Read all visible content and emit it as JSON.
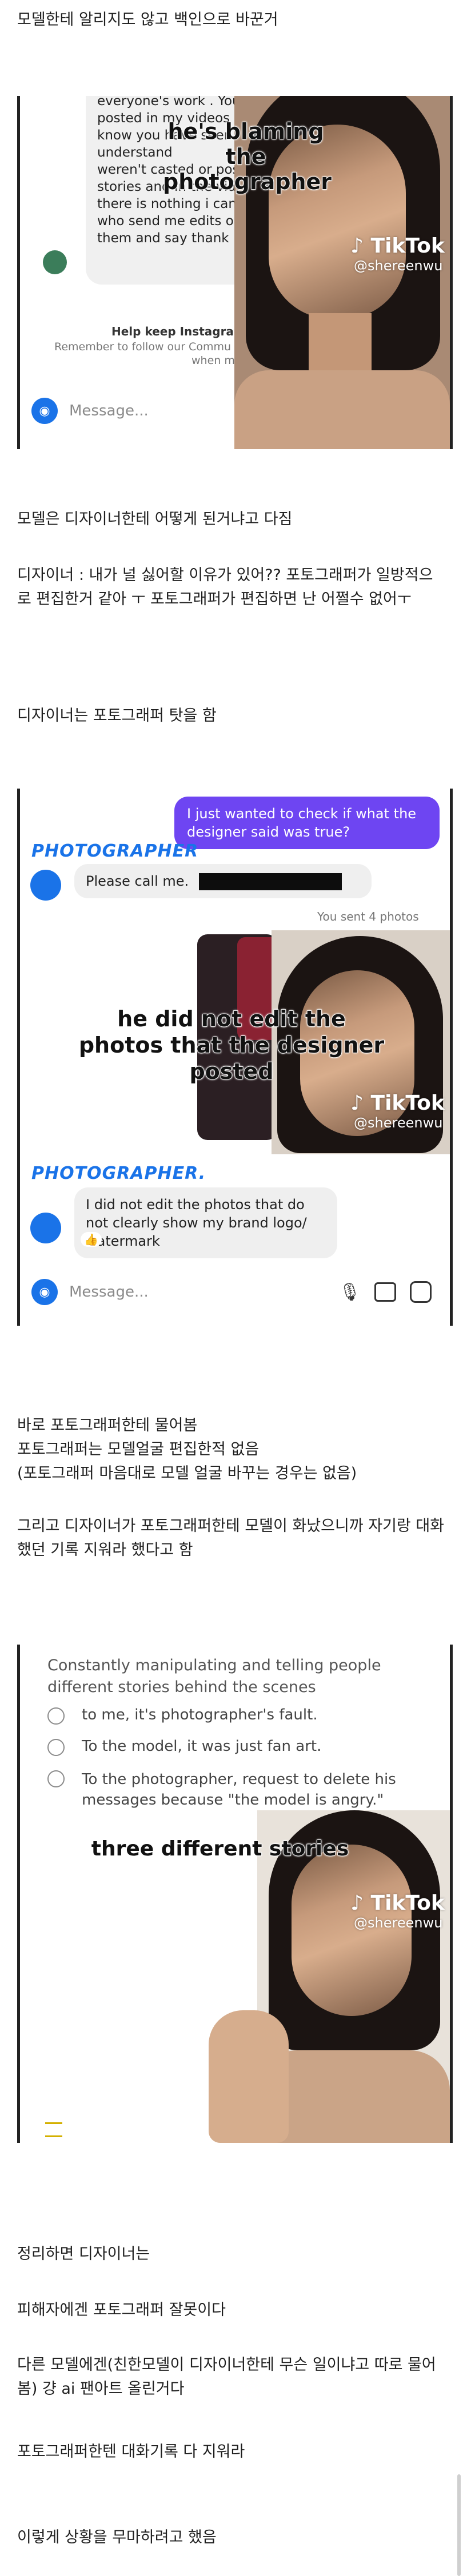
{
  "paragraphs": {
    "p1": "모델한테 알리지도 않고 백인으로 바꾼거",
    "p2": "모델은 디자이너한테 어떻게 된거냐고 다짐",
    "p3": "디자이너 : 내가 널 싫어할 이유가 있어?? 포토그래퍼가 일방적으로 편집한거 같아 ㅜ 포토그래퍼가 편집하면 난 어쩔수 없어ㅜ",
    "p4": "디자이너는 포토그래퍼 탓을 함",
    "p5a": "바로 포토그래퍼한테 물어봄",
    "p5b": "포토그래퍼는 모델얼굴 편집한적 없음",
    "p5c": "(포토그래퍼 마음대로 모델 얼굴 바꾸는 경우는 없음)",
    "p6": "그리고 디자이너가 포토그래퍼한테 모델이 화났으니까 자기랑 대화했던 기록 지워라 했다고 함",
    "p7": "정리하면 디자이너는",
    "p8": "피해자에겐 포토그래퍼 잘못이다",
    "p9": "다른 모델에겐(친한모델이 디자이너한테 무슨 일이냐고 따로 물어봄) 걍 ai 팬아트 올린거다",
    "p10": "포토그래퍼한텐 대화기록 다 지워라",
    "p11": "이렇게 상황을 무마하려고 했음"
  },
  "shot1": {
    "message_lines": [
      "everyone's work . Your photo was",
      "posted in my videos - and stories",
      "know you have seen it. I",
      "understand",
      "weren't casted or post",
      "stories and in the vide",
      "there is nothing i can",
      "who send me edits o",
      "them and say thank"
    ],
    "caption": "he's blaming the photographer",
    "help_title": "Help keep Instagram",
    "help_sub": "Remember to follow our Commu",
    "help_sub2": "when mess",
    "placeholder": "Message...",
    "tiktok": "TikTok",
    "handle": "@shereenwu"
  },
  "shot2": {
    "sent_message": "I just wanted to check if what the designer said was true?",
    "label1": "PHOTOGRAPHER",
    "reply1": "Please call me.",
    "sent_photos": "You sent 4 photos",
    "caption": "he did not edit the photos that the designer posted",
    "label2": "PHOTOGRAPHER.",
    "reply2": "I did not edit the photos that do not clearly show my brand logo/ watermark",
    "reaction": "👍",
    "placeholder": "Message...",
    "tiktok": "TikTok",
    "handle": "@shereenwu"
  },
  "shot3": {
    "heading": "Constantly manipulating and telling people different stories behind the scenes",
    "options": [
      "to me, it's photographer's fault.",
      "To the model, it was just fan art.",
      "To the photographer, request to delete his messages because \"the model is angry.\""
    ],
    "caption": "three different stories",
    "tiktok": "TikTok",
    "handle": "@shereenwu"
  }
}
